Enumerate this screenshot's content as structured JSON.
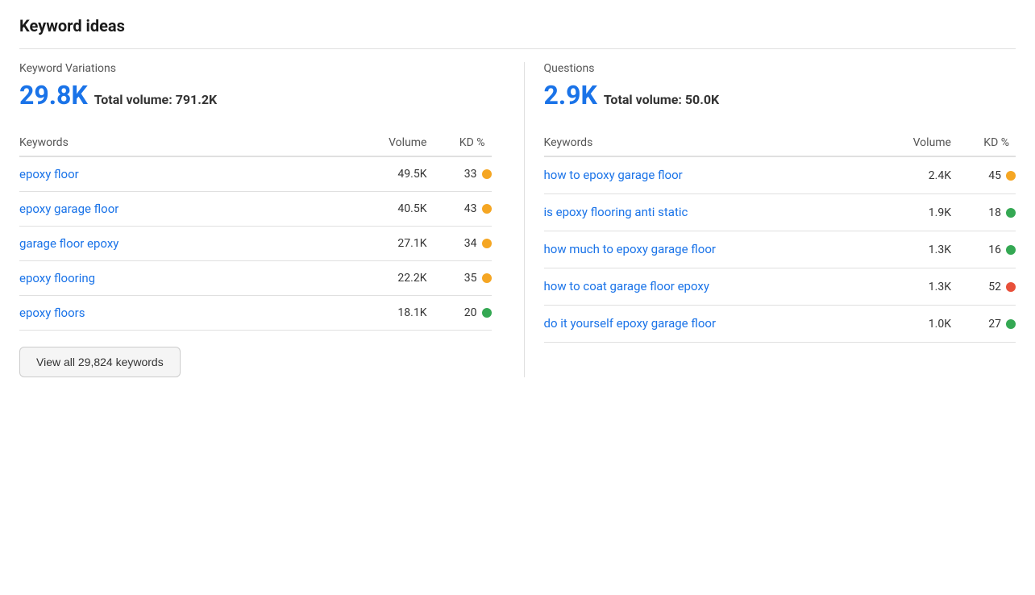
{
  "page": {
    "title": "Keyword ideas"
  },
  "variations": {
    "section_label": "Keyword Variations",
    "count": "29.8K",
    "total_volume_label": "Total volume:",
    "total_volume_value": "791.2K",
    "col_keywords": "Keywords",
    "col_volume": "Volume",
    "col_kd": "KD %",
    "rows": [
      {
        "keyword": "epoxy floor",
        "volume": "49.5K",
        "kd": "33",
        "dot": "orange"
      },
      {
        "keyword": "epoxy garage floor",
        "volume": "40.5K",
        "kd": "43",
        "dot": "orange"
      },
      {
        "keyword": "garage floor epoxy",
        "volume": "27.1K",
        "kd": "34",
        "dot": "orange"
      },
      {
        "keyword": "epoxy flooring",
        "volume": "22.2K",
        "kd": "35",
        "dot": "orange"
      },
      {
        "keyword": "epoxy floors",
        "volume": "18.1K",
        "kd": "20",
        "dot": "green"
      }
    ],
    "view_all_label": "View all 29,824 keywords"
  },
  "questions": {
    "section_label": "Questions",
    "count": "2.9K",
    "total_volume_label": "Total volume:",
    "total_volume_value": "50.0K",
    "col_keywords": "Keywords",
    "col_volume": "Volume",
    "col_kd": "KD %",
    "rows": [
      {
        "keyword": "how to epoxy garage floor",
        "volume": "2.4K",
        "kd": "45",
        "dot": "orange",
        "multiline": false
      },
      {
        "keyword": "is epoxy flooring anti static",
        "volume": "1.9K",
        "kd": "18",
        "dot": "green",
        "multiline": false
      },
      {
        "keyword": "how much to epoxy garage floor",
        "volume": "1.3K",
        "kd": "16",
        "dot": "green",
        "multiline": true
      },
      {
        "keyword": "how to coat garage floor epoxy",
        "volume": "1.3K",
        "kd": "52",
        "dot": "red",
        "multiline": true
      },
      {
        "keyword": "do it yourself epoxy garage floor",
        "volume": "1.0K",
        "kd": "27",
        "dot": "green",
        "multiline": true
      }
    ]
  }
}
